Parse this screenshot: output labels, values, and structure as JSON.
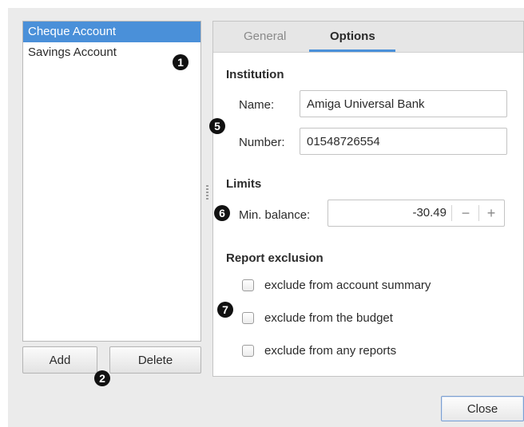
{
  "accounts": {
    "items": [
      {
        "label": "Cheque Account",
        "selected": true
      },
      {
        "label": "Savings Account",
        "selected": false
      }
    ]
  },
  "buttons": {
    "add_label": "Add",
    "delete_label": "Delete",
    "close_label": "Close"
  },
  "tabs": [
    {
      "label": "General",
      "active": false
    },
    {
      "label": "Options",
      "active": true
    }
  ],
  "institution": {
    "heading": "Institution",
    "name_label": "Name:",
    "name_value": "Amiga Universal Bank",
    "number_label": "Number:",
    "number_value": "01548726554"
  },
  "limits": {
    "heading": "Limits",
    "min_balance_label": "Min. balance:",
    "min_balance_value": "-30.49",
    "decrement_symbol": "−",
    "increment_symbol": "+"
  },
  "report_exclusion": {
    "heading": "Report exclusion",
    "options": [
      {
        "label": "exclude from account summary",
        "checked": false
      },
      {
        "label": "exclude from the budget",
        "checked": false
      },
      {
        "label": "exclude from any reports",
        "checked": false
      }
    ]
  },
  "callouts": {
    "c1": "1",
    "c2": "2",
    "c5": "5",
    "c6": "6",
    "c7": "7"
  },
  "colors": {
    "selection": "#4a90d9",
    "tab_underline": "#4a90d9"
  }
}
